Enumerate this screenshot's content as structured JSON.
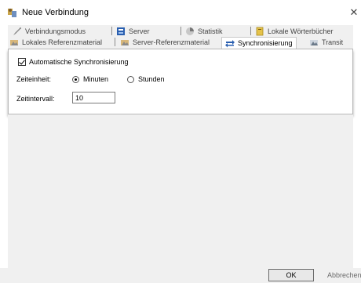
{
  "window": {
    "title": "Neue Verbindung",
    "close_glyph": "✕"
  },
  "tabs_row1": [
    {
      "label": "Verbindungsmodus",
      "icon": "pen-icon"
    },
    {
      "label": "Server",
      "icon": "server-icon"
    },
    {
      "label": "Statistik",
      "icon": "statistics-icon"
    },
    {
      "label": "Lokale Wörterbücher",
      "icon": "dictionary-icon"
    }
  ],
  "tabs_row2": [
    {
      "label": "Lokales Referenzmaterial",
      "icon": "local-reference-icon"
    },
    {
      "label": "Server-Referenzmaterial",
      "icon": "server-reference-icon"
    },
    {
      "label": "Synchronisierung",
      "icon": "sync-arrows-icon",
      "active": true
    },
    {
      "label": "Transit",
      "icon": "transit-icon"
    }
  ],
  "sync": {
    "auto_label": "Automatische Synchronisierung",
    "auto_checked": true,
    "unit_label": "Zeiteinheit:",
    "unit_minutes": "Minuten",
    "unit_hours": "Stunden",
    "unit_selected": "Minuten",
    "interval_label": "Zeitintervall:",
    "interval_value": "10"
  },
  "buttons": {
    "ok": "OK",
    "cancel": "Abbrechen"
  },
  "colors": {
    "accent_blue": "#2a5fb0",
    "panel_bg": "#f0f0f0"
  }
}
